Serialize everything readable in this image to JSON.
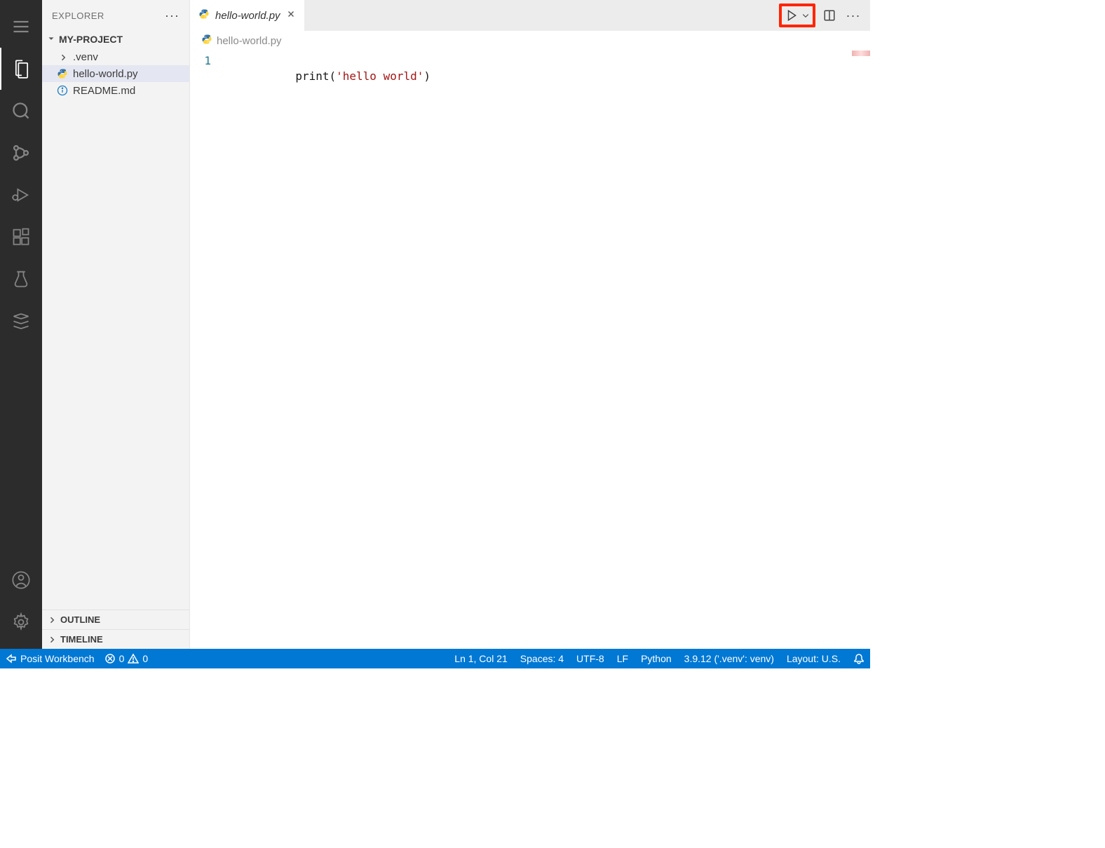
{
  "sidebar": {
    "title": "EXPLORER",
    "project_name": "MY-PROJECT",
    "items": [
      {
        "label": ".venv",
        "type": "folder"
      },
      {
        "label": "hello-world.py",
        "type": "python",
        "selected": true
      },
      {
        "label": "README.md",
        "type": "info"
      }
    ],
    "outline_label": "OUTLINE",
    "timeline_label": "TIMELINE"
  },
  "tabs": {
    "active_tab": "hello-world.py"
  },
  "breadcrumb": {
    "file": "hello-world.py"
  },
  "editor": {
    "line_number": "1",
    "code": {
      "fn": "print",
      "open": "(",
      "str": "'hello world'",
      "close": ")"
    }
  },
  "status": {
    "remote": "Posit Workbench",
    "errors": "0",
    "warnings": "0",
    "cursor": "Ln 1, Col 21",
    "spaces": "Spaces: 4",
    "encoding": "UTF-8",
    "eol": "LF",
    "language": "Python",
    "interpreter": "3.9.12 ('.venv': venv)",
    "layout": "Layout: U.S."
  }
}
